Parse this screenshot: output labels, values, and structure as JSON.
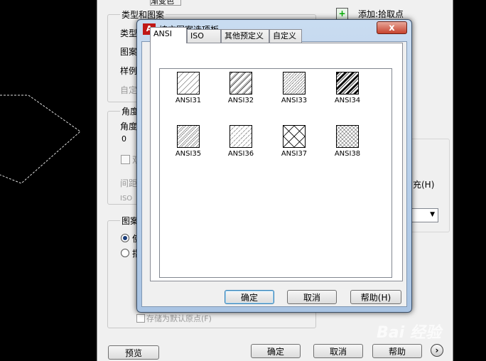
{
  "background_dialog": {
    "tab_partial": "渐变色",
    "type_and_pattern": "类型和图案",
    "type_label": "类型",
    "pattern_label": "图案",
    "sample_label": "样例",
    "custom_label": "自定",
    "angle_group": "角度",
    "angle_label": "角度",
    "angle_value": "0",
    "double_label": "双",
    "spacing_label": "间距",
    "iso_label": "ISO",
    "origin_group": "图案",
    "use_label": "使",
    "specify_label": "指",
    "store_default_origin": "存储为默认原点(F)",
    "add_pick_points": "添加:拾取点",
    "fill_hotkey": "充(H)",
    "preview_button": "预览",
    "ok_button": "确定",
    "cancel_button": "取消",
    "help_button": "帮助",
    "more_button": "›"
  },
  "modal": {
    "title": "填充图案选项板",
    "close": "x",
    "tabs": [
      {
        "label": "ANSI",
        "active": true
      },
      {
        "label": "ISO",
        "active": false
      },
      {
        "label": "其他预定义",
        "active": false
      },
      {
        "label": "自定义",
        "active": false
      }
    ],
    "patterns": [
      {
        "name": "ANSI31"
      },
      {
        "name": "ANSI32"
      },
      {
        "name": "ANSI33"
      },
      {
        "name": "ANSI34"
      },
      {
        "name": "ANSI35"
      },
      {
        "name": "ANSI36"
      },
      {
        "name": "ANSI37"
      },
      {
        "name": "ANSI38"
      }
    ],
    "ok_button": "确定",
    "cancel_button": "取消",
    "help_button": "帮助(H)"
  },
  "watermark": "Bai 经验"
}
